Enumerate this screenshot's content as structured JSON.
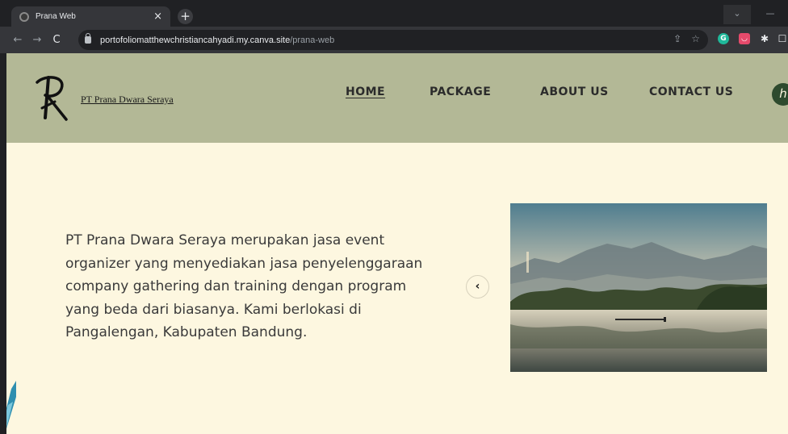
{
  "browser": {
    "tab_title": "Prana Web",
    "tab_close": "×",
    "new_tab": "+",
    "url_host": "portofoliomatthewchristiancahyadi.my.canva.site",
    "url_path": "/prana-web",
    "back_icon": "←",
    "forward_icon": "→",
    "reload_icon": "C"
  },
  "header": {
    "brand_name": "PT Prana Dwara Seraya",
    "nav": {
      "home": "HOME",
      "package": "PACKAGE",
      "about": "ABOUT US",
      "contact": "CONTACT US"
    },
    "active_nav": "home"
  },
  "hero": {
    "description": "PT Prana Dwara Seraya merupakan jasa event organizer yang menyediakan jasa penyelenggaraan company gathering dan training dengan program yang beda dari biasanya. Kami berlokasi di Pangalengan, Kabupaten Bandung.",
    "prev_label": "‹",
    "image_icon": "lake-landscape-photo"
  },
  "colors": {
    "header_bg": "#b3b896",
    "page_bg": "#fdf7e0",
    "text": "#3a3a3a",
    "chrome_dark": "#202124",
    "chrome_toolbar": "#35363a"
  }
}
